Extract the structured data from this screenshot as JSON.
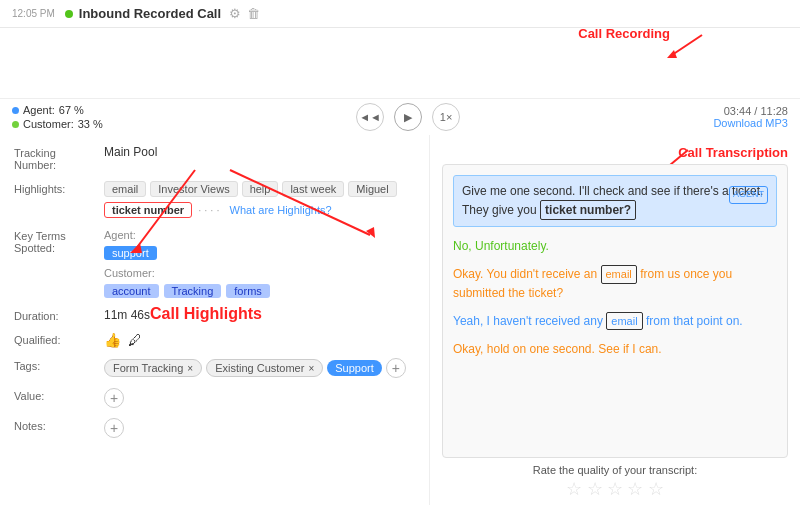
{
  "header": {
    "time": "12:05 PM",
    "title": "Inbound Recorded Call",
    "status_dot_color": "#52c41a"
  },
  "waveform": {
    "call_recording_label": "Call Recording",
    "highlight_position": "46%"
  },
  "controls": {
    "agent_label": "Agent:",
    "agent_percent": "67 %",
    "customer_label": "Customer:",
    "customer_percent": "33 %",
    "rewind_label": "◄◄",
    "play_label": "▶",
    "speed_label": "1×",
    "time_current": "03:44",
    "time_total": "11:28",
    "download_label": "Download MP3"
  },
  "tracking": {
    "label": "Tracking\nNumber:",
    "value": "Main Pool"
  },
  "highlights": {
    "label": "Highlights:",
    "chips": [
      "email",
      "Investor Views",
      "help",
      "last week",
      "Miguel"
    ],
    "highlighted_chip": "ticket number",
    "more_text": "What are Highlights?"
  },
  "call_highlights_annotation": "Call Highlights",
  "key_terms": {
    "label": "Key Terms\nSpotted:",
    "agent_label": "Agent:",
    "agent_term": "support",
    "customer_label": "Customer:",
    "customer_terms": [
      "account",
      "Tracking",
      "forms"
    ]
  },
  "duration": {
    "label": "Duration:",
    "value": "11m 46s"
  },
  "qualified": {
    "label": "Qualified:"
  },
  "tags": {
    "label": "Tags:",
    "items": [
      {
        "text": "Form Tracking",
        "type": "form-tracking"
      },
      {
        "text": "Existing Customer",
        "type": "existing-customer"
      },
      {
        "text": "Support",
        "type": "support"
      }
    ]
  },
  "value": {
    "label": "Value:"
  },
  "notes": {
    "label": "Notes:"
  },
  "transcription": {
    "call_transcription_label": "Call Transcription",
    "lines": [
      {
        "id": "line1",
        "text": "Give me one second. I'll check and see if there's a ticket. They give you",
        "highlighted_word": "ticket number?",
        "highlighted": true,
        "speaker": "AGENT"
      },
      {
        "id": "line2",
        "text": "No, Unfortunately.",
        "highlighted": false,
        "color": "green"
      },
      {
        "id": "line3",
        "text": "Okay. You didn't receive an",
        "inline_chip": "email",
        "text_after": "from us once you submitted the ticket?",
        "highlighted": false,
        "color": "orange"
      },
      {
        "id": "line4",
        "text": "Yeah, I haven't received any",
        "inline_chip": "email",
        "text_after": "from that point on.",
        "highlighted": false,
        "color": "blue"
      },
      {
        "id": "line5",
        "text": "Okay, hold on one second. See if I can.",
        "highlighted": false,
        "color": "orange"
      }
    ]
  },
  "rate_quality": {
    "label": "Rate the quality of your transcript:",
    "stars": [
      false,
      false,
      false,
      false,
      false
    ]
  }
}
